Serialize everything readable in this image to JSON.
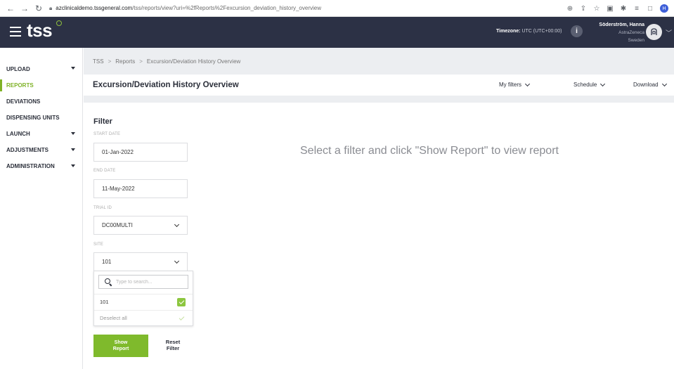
{
  "browser": {
    "url_host": "azclinicaldemo.tssgeneral.com",
    "url_path": "/tss/reports/view?uri=%2fReports%2Fexcursion_deviation_history_overview",
    "profile_initial": "H"
  },
  "header": {
    "logo": "tss",
    "timezone_label": "Timezone:",
    "timezone_value": "UTC (UTC+00:00)",
    "info_glyph": "i",
    "user_name": "Söderström, Hanna",
    "user_company": "AstraZeneca",
    "user_country": "Sweden"
  },
  "sidebar": {
    "items": [
      {
        "label": "UPLOAD",
        "has_caret": true
      },
      {
        "label": "REPORTS",
        "active": true
      },
      {
        "label": "DEVIATIONS"
      },
      {
        "label": "DISPENSING UNITS"
      },
      {
        "label": "LAUNCH",
        "has_caret": true
      },
      {
        "label": "ADJUSTMENTS",
        "has_caret": true
      },
      {
        "label": "ADMINISTRATION",
        "has_caret": true
      }
    ]
  },
  "breadcrumb": {
    "items": [
      "TSS",
      "Reports",
      "Excursion/Deviation History Overview"
    ],
    "separator": ">"
  },
  "title_bar": {
    "title": "Excursion/Deviation History Overview",
    "my_filters": "My filters",
    "schedule": "Schedule",
    "download": "Download"
  },
  "filter": {
    "heading": "Filter",
    "start_date_label": "START DATE",
    "start_date_value": "01-Jan-2022",
    "end_date_label": "END DATE",
    "end_date_value": "11-May-2022",
    "trial_id_label": "TRIAL ID",
    "trial_id_value": "DC00MULTI",
    "site_label": "SITE",
    "site_value": "101",
    "search_placeholder": "Type to search...",
    "options": [
      {
        "label": "101",
        "checked": true
      }
    ],
    "deselect_all": "Deselect all",
    "show_report_line1": "Show",
    "show_report_line2": "Report",
    "reset_line1": "Reset",
    "reset_line2": "Filter"
  },
  "main": {
    "empty_message": "Select a filter and click \"Show Report\" to view report"
  },
  "colors": {
    "header_bg": "#2c3145",
    "accent_green": "#7fba2c",
    "breadcrumb_bg": "#eceef1"
  }
}
